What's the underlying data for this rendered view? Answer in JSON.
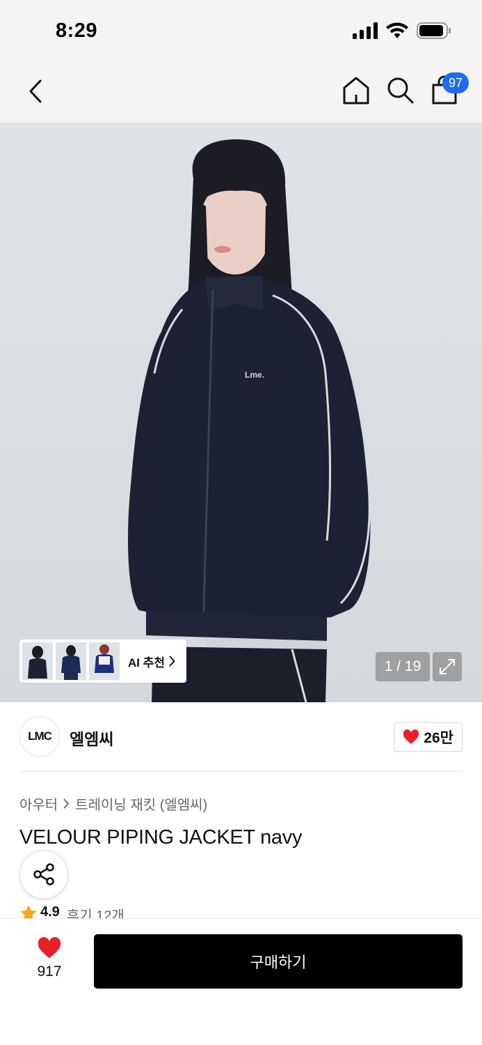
{
  "status_bar": {
    "time": "8:29"
  },
  "nav": {
    "back_icon": "chevron-left-icon",
    "home_icon": "home-icon",
    "search_icon": "search-icon",
    "cart_icon": "shopping-bag-icon",
    "cart_badge": "97",
    "badge_color": "#1f6bf0"
  },
  "gallery": {
    "ai_recommend_label": "AI 추천",
    "page_counter": "1 / 19",
    "expand_icon": "expand-icon"
  },
  "brand": {
    "logo_text": "LMC",
    "name": "엘엠씨",
    "likes": "26만",
    "heart_color": "#e8202a"
  },
  "breadcrumb": {
    "category": "아우터",
    "subcategory": "트레이닝 재킷 (엘엠씨)"
  },
  "product": {
    "title": "VELOUR PIPING JACKET navy",
    "rating": "4.9",
    "reviews": "후기 12개"
  },
  "bottom_bar": {
    "wish_count": "917",
    "buy_label": "구매하기"
  }
}
